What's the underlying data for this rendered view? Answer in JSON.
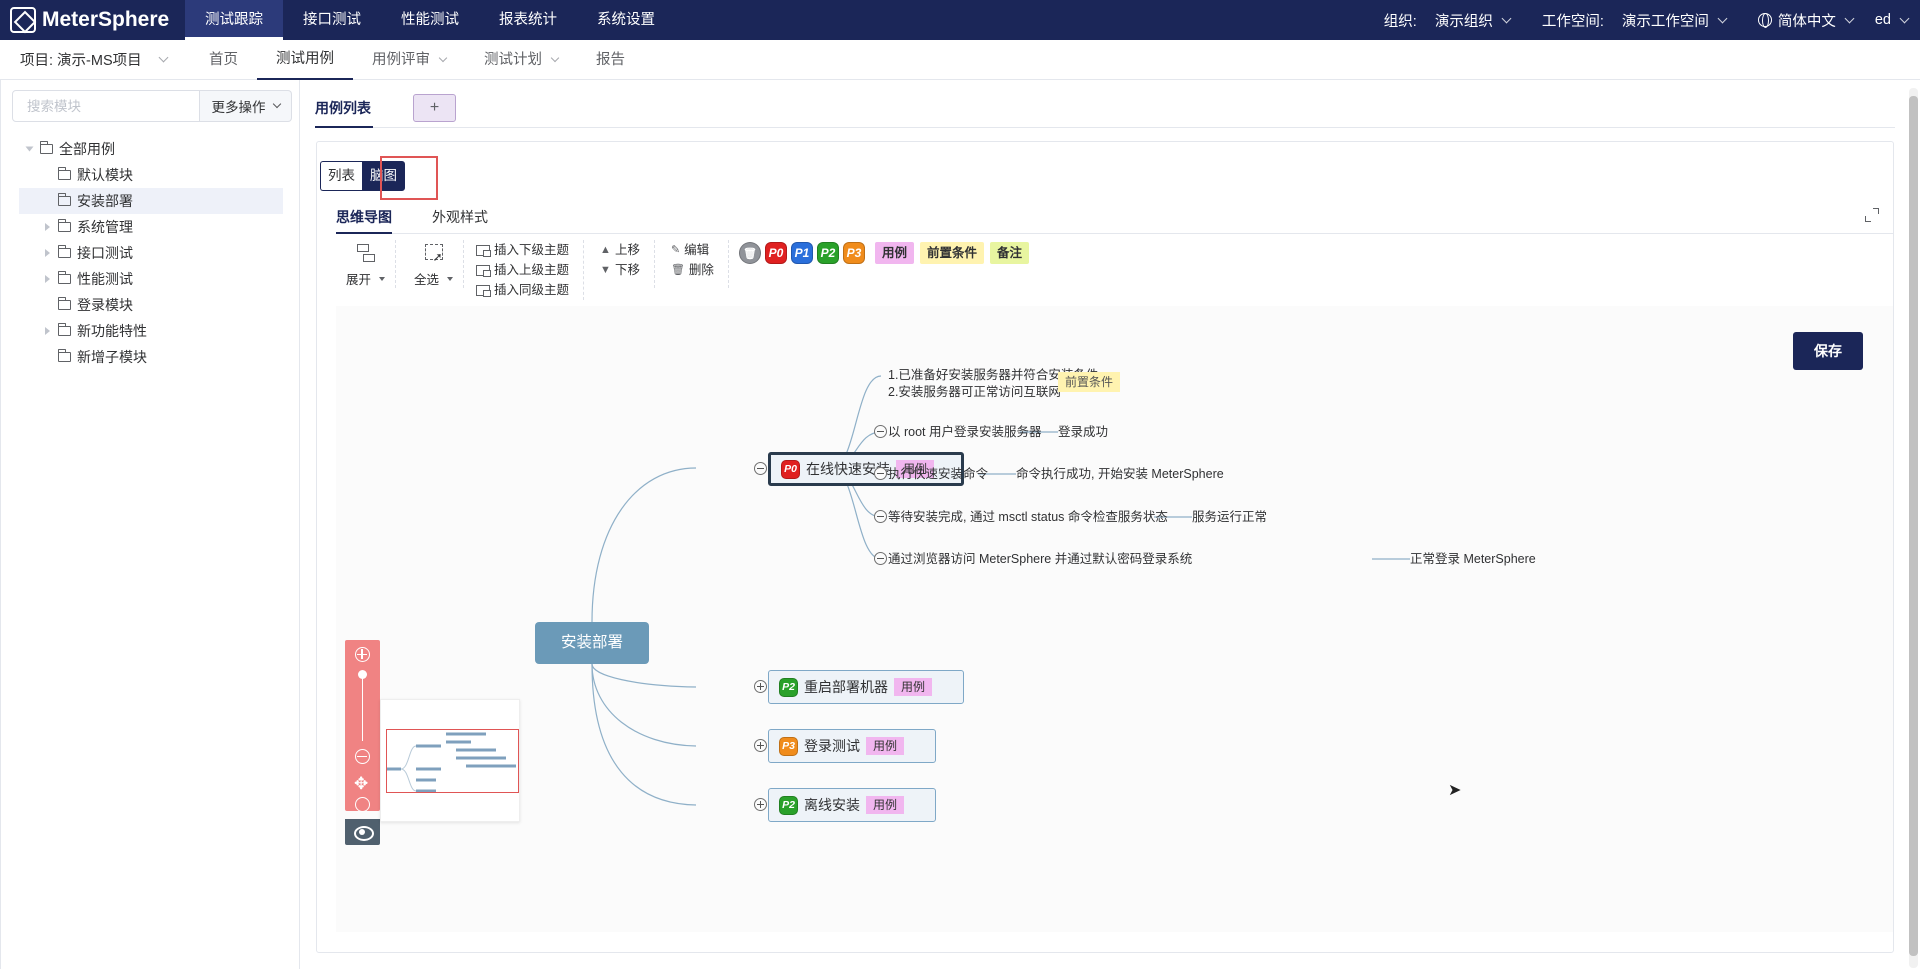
{
  "app": {
    "name": "MeterSphere"
  },
  "topnav": {
    "items": [
      "测试跟踪",
      "接口测试",
      "性能测试",
      "报表统计",
      "系统设置"
    ],
    "active": 0
  },
  "topright": {
    "org_label": "组织:",
    "org_value": "演示组织",
    "ws_label": "工作空间:",
    "ws_value": "演示工作空间",
    "lang": "简体中文",
    "user": "ed"
  },
  "subbar": {
    "project": "项目: 演示-MS项目",
    "items": [
      "首页",
      "测试用例",
      "用例评审",
      "测试计划",
      "报告"
    ],
    "active": 1
  },
  "sidebar": {
    "search_placeholder": "搜索模块",
    "more_button": "更多操作",
    "tree": [
      {
        "label": "全部用例"
      },
      {
        "label": "默认模块"
      },
      {
        "label": "安装部署"
      },
      {
        "label": "系统管理"
      },
      {
        "label": "接口测试"
      },
      {
        "label": "性能测试"
      },
      {
        "label": "登录模块"
      },
      {
        "label": "新功能特性"
      },
      {
        "label": "新增子模块"
      }
    ]
  },
  "main": {
    "tab_label": "用例列表",
    "add_tab": "+",
    "view_list": "列表",
    "view_mindmap": "脑图",
    "mindmap_tabs": [
      "思维导图",
      "外观样式"
    ],
    "toolbar": {
      "expand": "展开",
      "select_all": "全选",
      "insert_child": "插入下级主题",
      "insert_parent": "插入上级主题",
      "insert_sibling": "插入同级主题",
      "move_up": "上移",
      "move_down": "下移",
      "edit": "编辑",
      "delete": "删除",
      "priorities": [
        "P0",
        "P1",
        "P2",
        "P3"
      ],
      "priority_colors": [
        "#e02020",
        "#2a6fdb",
        "#2aa12a",
        "#f08c1c"
      ],
      "tags": [
        "用例",
        "前置条件",
        "备注"
      ],
      "tag_colors": [
        "#f1b6ef",
        "#fff3b0",
        "#e8f5a0"
      ]
    },
    "save_button": "保存"
  },
  "mindmap": {
    "root": "安装部署",
    "cases": [
      {
        "priority": "P0",
        "title": "在线快速安装",
        "tag": "用例"
      },
      {
        "priority": "P2",
        "title": "重启部署机器",
        "tag": "用例"
      },
      {
        "priority": "P3",
        "title": "登录测试",
        "tag": "用例"
      },
      {
        "priority": "P2",
        "title": "离线安装",
        "tag": "用例"
      }
    ],
    "precondition": {
      "line1": "1.已准备好安装服务器并符合安装条件",
      "line2": "2.安装服务器可正常访问互联网",
      "tag": "前置条件"
    },
    "steps": [
      {
        "step": "以 root 用户登录安装服务器",
        "result": "登录成功"
      },
      {
        "step": "执行快速安装命令",
        "result": "命令执行成功, 开始安装 MeterSphere"
      },
      {
        "step": "等待安装完成, 通过 msctl status 命令检查服务状态",
        "result": "服务运行正常"
      },
      {
        "step": "通过浏览器访问 MeterSphere 并通过默认密码登录系统",
        "result": "正常登录 MeterSphere"
      }
    ]
  }
}
